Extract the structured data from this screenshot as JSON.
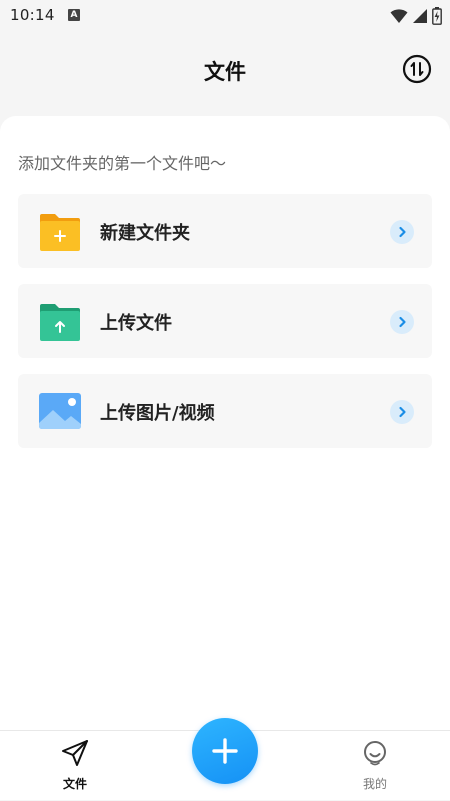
{
  "status_bar": {
    "time": "10:14",
    "notification_icon": "a-letter-icon",
    "icons": [
      "wifi-icon",
      "signal-icon",
      "battery-icon"
    ]
  },
  "header": {
    "title": "文件",
    "sort_icon": "sort-arrows-icon"
  },
  "main": {
    "hint": "添加文件夹的第一个文件吧～",
    "actions": [
      {
        "label": "新建文件夹",
        "icon": "new-folder-icon",
        "color": "#f8b61f"
      },
      {
        "label": "上传文件",
        "icon": "upload-file-folder-icon",
        "color": "#2fbf8e"
      },
      {
        "label": "上传图片/视频",
        "icon": "image-icon",
        "color": "#4a9ff5"
      }
    ]
  },
  "bottom_nav": {
    "tabs": [
      {
        "label": "文件",
        "icon": "paper-plane-icon",
        "active": true
      },
      {
        "label": "我的",
        "icon": "smiley-face-icon",
        "active": false
      }
    ],
    "fab_icon": "plus-icon"
  },
  "colors": {
    "accent": "#1a9bf8",
    "chevron_bg": "#d9ecfb",
    "chevron_fg": "#1a8de6",
    "page_bg": "#f5f5f5",
    "card_bg": "#f7f7f7"
  }
}
